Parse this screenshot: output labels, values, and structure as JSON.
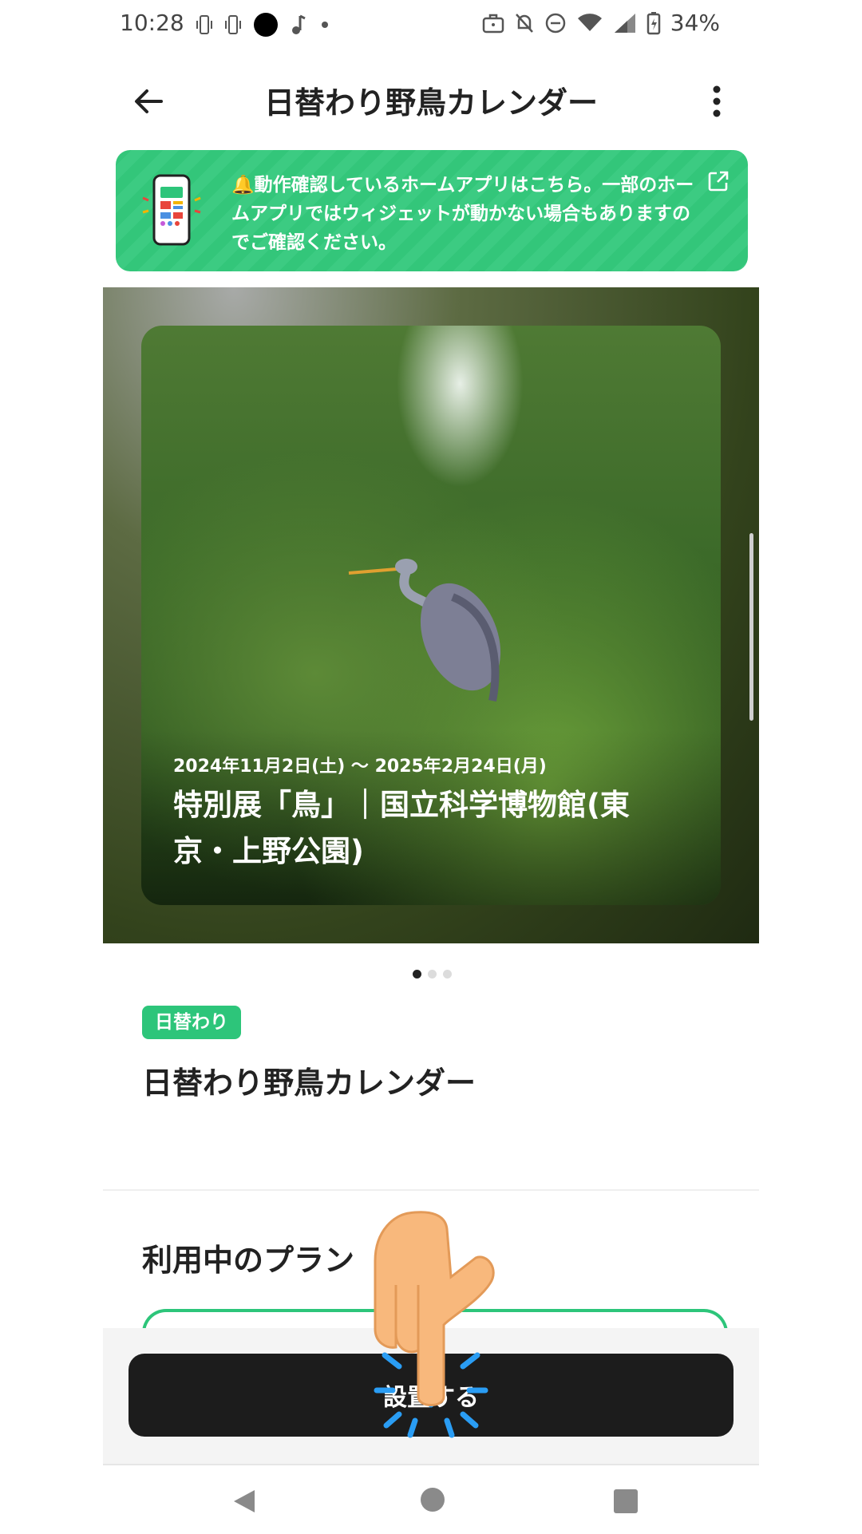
{
  "status_bar": {
    "time": "10:28",
    "battery": "34%",
    "icons_left": [
      "vibrate-icon",
      "vibrate-icon",
      "circle-icon",
      "music-note-icon",
      "dot-icon"
    ],
    "icons_right": [
      "briefcase-icon",
      "bell-off-icon",
      "do-not-disturb-icon",
      "wifi-icon",
      "signal-icon",
      "battery-icon"
    ]
  },
  "header": {
    "title": "日替わり野鳥カレンダー"
  },
  "banner": {
    "text": "🔔動作確認しているホームアプリはこちら。一部のホームアプリではウィジェットが動かない場合もありますのでご確認ください。"
  },
  "hero": {
    "date": "2024年11月2日(土) 〜 2025年2月24日(月)",
    "title": "特別展「鳥」｜国立科学博物館(東京・上野公園)"
  },
  "pagination": {
    "total": 3,
    "active": 0
  },
  "widget": {
    "tag": "日替わり",
    "title": "日替わり野鳥カレンダー"
  },
  "plan": {
    "heading": "利用中のプラン"
  },
  "action": {
    "install_label": "設置する"
  },
  "colors": {
    "accent": "#2dc57a",
    "button_dark": "#1c1c1c"
  }
}
